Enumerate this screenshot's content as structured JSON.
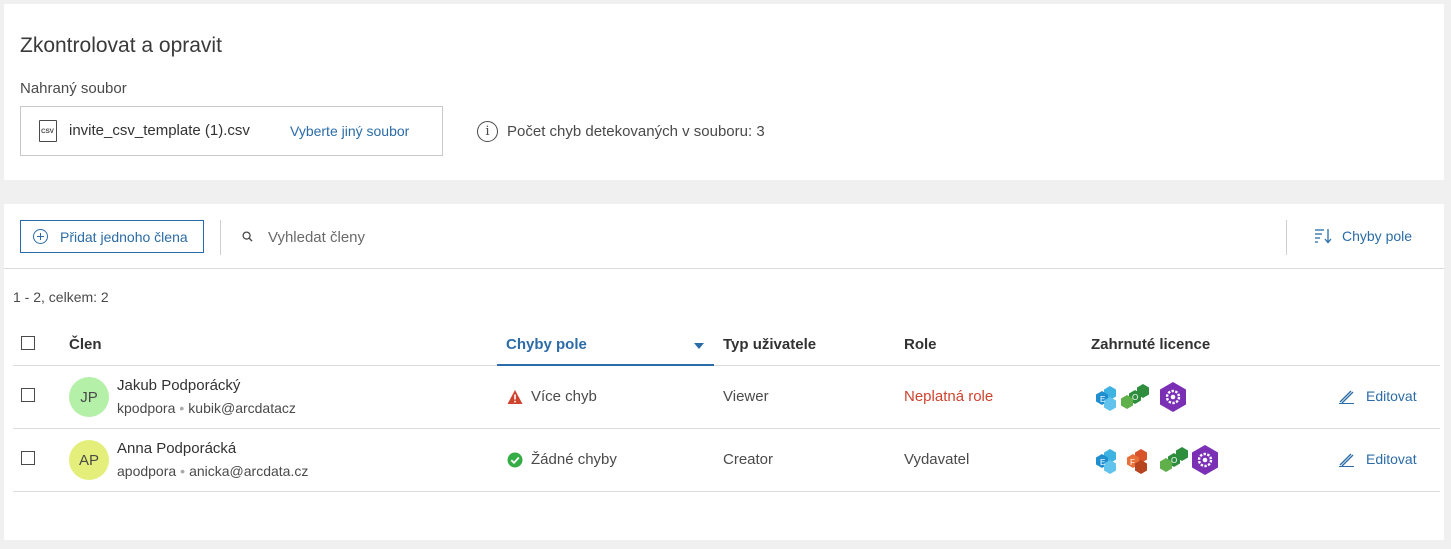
{
  "header": {
    "title": "Zkontrolovat a opravit",
    "file_label": "Nahraný soubor",
    "file_icon_text": "CSV",
    "file_name": "invite_csv_template (1).csv",
    "choose_other": "Vyberte jiný soubor",
    "error_info": "Počet chyb detekovaných v souboru: 3"
  },
  "toolbar": {
    "add_member": "Přidat jednoho člena",
    "search_placeholder": "Vyhledat členy",
    "sort_label": "Chyby pole"
  },
  "count_text": "1 - 2, celkem: 2",
  "table": {
    "columns": {
      "member": "Člen",
      "field_errors": "Chyby pole",
      "user_type": "Typ uživatele",
      "role": "Role",
      "licenses": "Zahrnuté licence"
    },
    "rows": [
      {
        "initials": "JP",
        "avatar_color": "#b4f0a8",
        "name": "Jakub Podporácký",
        "username": "kpodpora",
        "email": "kubik@arcdatacz",
        "status": "Více chyb",
        "status_type": "error",
        "user_type": "Viewer",
        "role": "Neplatná role",
        "role_invalid": true,
        "licenses": [
          "E",
          "O",
          "gear"
        ],
        "edit": "Editovat"
      },
      {
        "initials": "AP",
        "avatar_color": "#e3ef7a",
        "name": "Anna Podporácká",
        "username": "apodpora",
        "email": "anicka@arcdata.cz",
        "status": "Žádné chyby",
        "status_type": "ok",
        "user_type": "Creator",
        "role": "Vydavatel",
        "role_invalid": false,
        "licenses": [
          "E",
          "F",
          "O",
          "gear"
        ],
        "edit": "Editovat"
      }
    ]
  },
  "colors": {
    "accent": "#2b6ca8",
    "error": "#d0432f",
    "success": "#35ac46"
  }
}
